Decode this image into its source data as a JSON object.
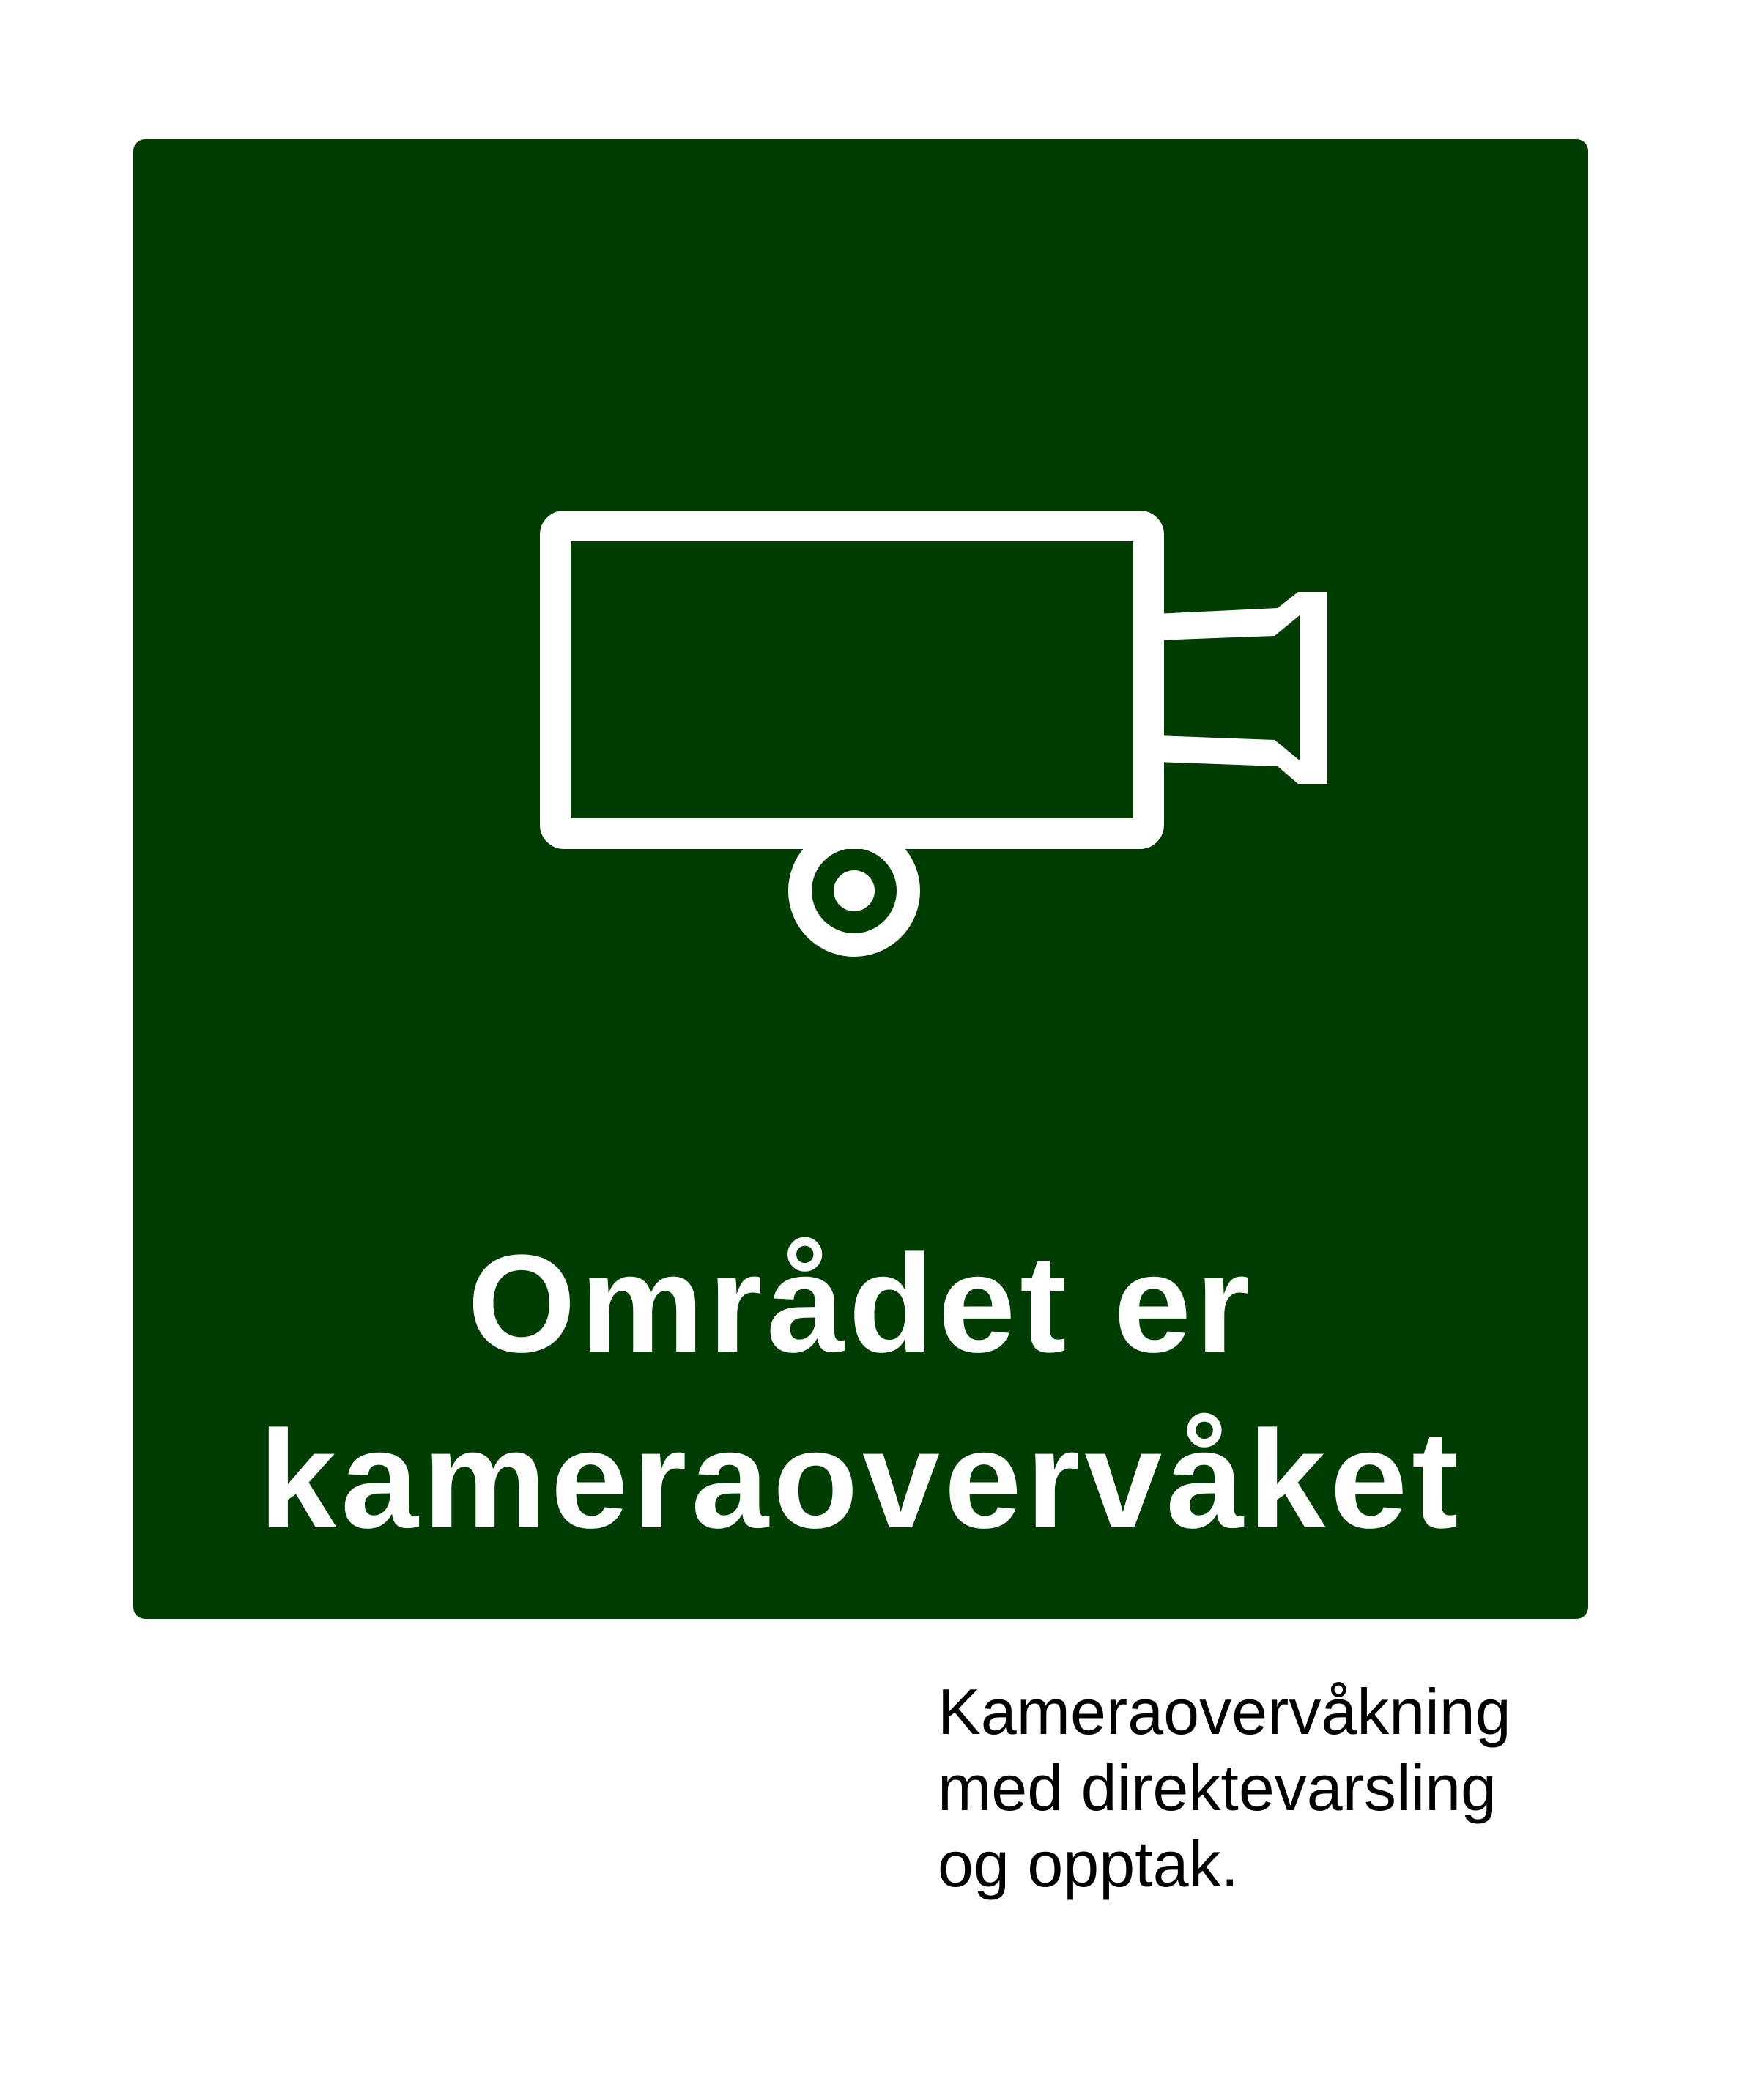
{
  "sign": {
    "background_color": "#003d02",
    "foreground_color": "#ffffff",
    "icon": "security-camera-icon",
    "headline": {
      "line1": "Området er",
      "line2": "kameraovervåket"
    }
  },
  "caption": {
    "text_color": "#000000",
    "lines": [
      "Kameraovervåkning",
      "med direktevarsling",
      "og opptak."
    ]
  }
}
